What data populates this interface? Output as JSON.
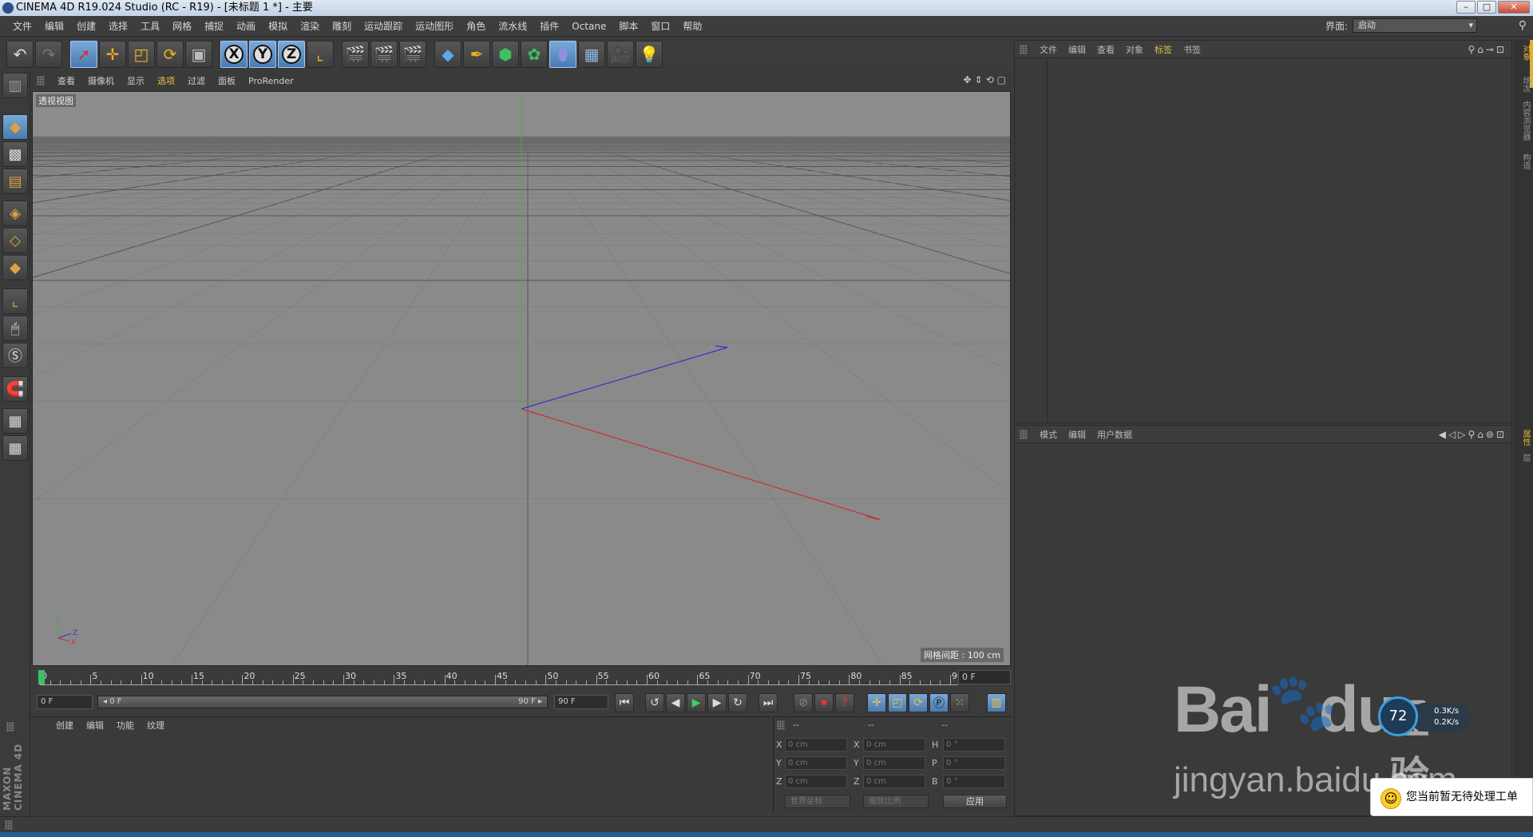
{
  "window": {
    "title": "CINEMA 4D R19.024 Studio (RC - R19) - [未标题 1 *] - 主要",
    "buttons": {
      "minimize": "–",
      "maximize": "□",
      "close": "✕"
    }
  },
  "menubar": {
    "items": [
      "文件",
      "编辑",
      "创建",
      "选择",
      "工具",
      "网格",
      "捕捉",
      "动画",
      "模拟",
      "渲染",
      "雕刻",
      "运动跟踪",
      "运动图形",
      "角色",
      "流水线",
      "插件",
      "Octane",
      "脚本",
      "窗口",
      "帮助"
    ],
    "layout_label": "界面:",
    "layout_value": "启动"
  },
  "viewport": {
    "menu": [
      "查看",
      "摄像机",
      "显示",
      "选项",
      "过滤",
      "面板",
      "ProRender"
    ],
    "active_menu_index": 3,
    "label": "透视视图",
    "grid_info": "网格间距 : 100 cm",
    "axis_labels": {
      "y": "Y",
      "z": "Z",
      "x": "X"
    },
    "colors": {
      "x_axis": "#c83232",
      "y_axis": "#3cb43c",
      "z_axis": "#3232c8",
      "background": "#8a8a8a"
    }
  },
  "timeline": {
    "ticks": [
      "0",
      "5",
      "10",
      "15",
      "20",
      "25",
      "30",
      "35",
      "40",
      "45",
      "50",
      "55",
      "60",
      "65",
      "70",
      "75",
      "80",
      "85",
      "90"
    ],
    "current_frame": "0 F"
  },
  "transport": {
    "start_field": "0 F",
    "range_start": "◂ 0 F",
    "range_end": "90 F ▸",
    "end_field": "90 F"
  },
  "material_panel": {
    "menu": [
      "创建",
      "编辑",
      "功能",
      "纹理"
    ]
  },
  "coord_panel": {
    "headers": [
      "--",
      "--",
      "--"
    ],
    "rows": [
      {
        "l1": "X",
        "v1": "0 cm",
        "l2": "X",
        "v2": "0 cm",
        "l3": "H",
        "v3": "0 °"
      },
      {
        "l1": "Y",
        "v1": "0 cm",
        "l2": "Y",
        "v2": "0 cm",
        "l3": "P",
        "v3": "0 °"
      },
      {
        "l1": "Z",
        "v1": "0 cm",
        "l2": "Z",
        "v2": "0 cm",
        "l3": "B",
        "v3": "0 °"
      }
    ],
    "coord_mode": "世界坐标",
    "scale_mode": "缩放比例",
    "apply": "应用"
  },
  "object_manager": {
    "menu": [
      "文件",
      "编辑",
      "查看",
      "对象",
      "标签",
      "书签"
    ],
    "active_menu_index": 4
  },
  "attribute_manager": {
    "menu": [
      "模式",
      "编辑",
      "用户数据"
    ]
  },
  "right_tabs": {
    "tab1": "对象",
    "tab2": "场次",
    "tab3": "内容浏览器",
    "tab4": "构造",
    "tab5": "属性",
    "tab6": "层"
  },
  "maxon_logo": "MAXON CINEMA 4D",
  "watermark": {
    "brand": "Bai",
    "brand2": "du",
    "jingyan": "经验",
    "url": "jingyan.baidu.com"
  },
  "net_widget": {
    "value": "72",
    "up": "0.3K/s",
    "down": "0.2K/s"
  },
  "notice": {
    "text": "您当前暂无待处理工单"
  }
}
